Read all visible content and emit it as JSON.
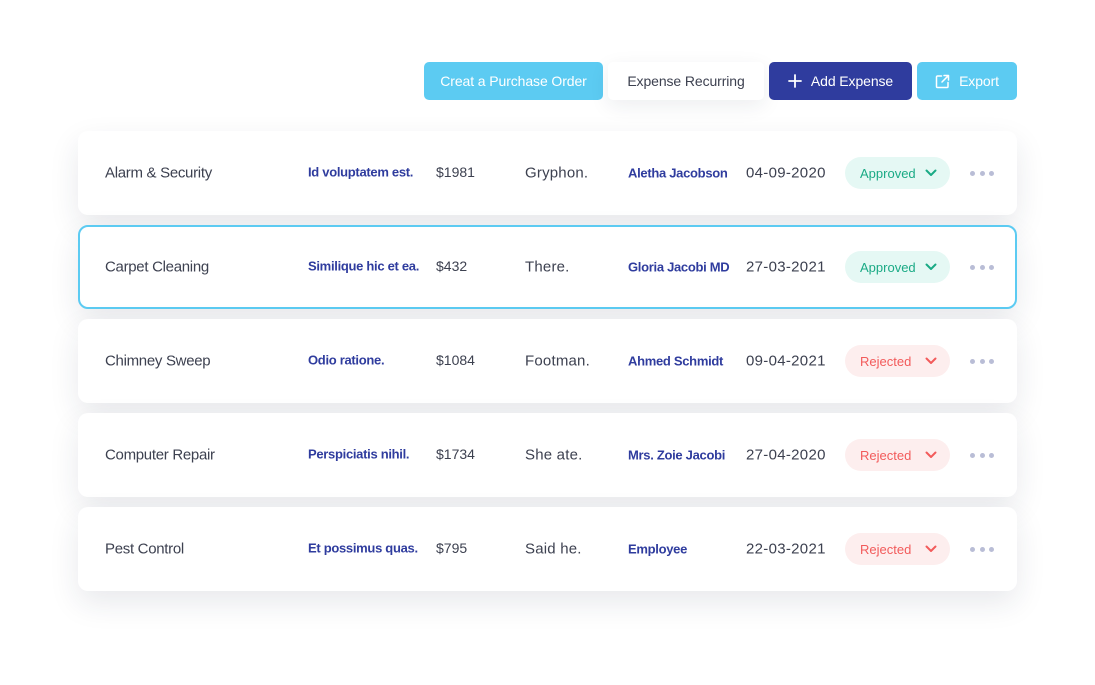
{
  "toolbar": {
    "purchase_order_label": "Creat a Purchase Order",
    "recurring_label": "Expense Recurring",
    "add_expense_label": "Add Expense",
    "export_label": "Export"
  },
  "colors": {
    "primary": "#2f3c9e",
    "accent": "#5ccbf2",
    "approved_text": "#1aaa85",
    "approved_bg": "#e5f8f4",
    "rejected_text": "#f25b5b",
    "rejected_bg": "#fdeeee"
  },
  "icons": {
    "add": "plus-icon",
    "export": "external-link-icon",
    "status": "chevron-down-icon",
    "more": "more-horizontal-icon"
  },
  "expenses": [
    {
      "category": "Alarm & Security",
      "description": "Id voluptatem est.",
      "amount": "$1981",
      "note": "Gryphon.",
      "employee": "Aletha Jacobson",
      "date": "04-09-2020",
      "status": "Approved",
      "selected": false
    },
    {
      "category": "Carpet Cleaning",
      "description": "Similique hic et ea.",
      "amount": "$432",
      "note": "There.",
      "employee": "Gloria Jacobi MD",
      "date": "27-03-2021",
      "status": "Approved",
      "selected": true
    },
    {
      "category": "Chimney Sweep",
      "description": "Odio ratione.",
      "amount": "$1084",
      "note": "Footman.",
      "employee": "Ahmed Schmidt",
      "date": "09-04-2021",
      "status": "Rejected",
      "selected": false
    },
    {
      "category": "Computer Repair",
      "description": "Perspiciatis nihil.",
      "amount": "$1734",
      "note": "She ate.",
      "employee": "Mrs. Zoie Jacobi",
      "date": "27-04-2020",
      "status": "Rejected",
      "selected": false
    },
    {
      "category": "Pest Control",
      "description": "Et possimus quas.",
      "amount": "$795",
      "note": "Said he.",
      "employee": "Employee",
      "date": "22-03-2021",
      "status": "Rejected",
      "selected": false
    }
  ]
}
